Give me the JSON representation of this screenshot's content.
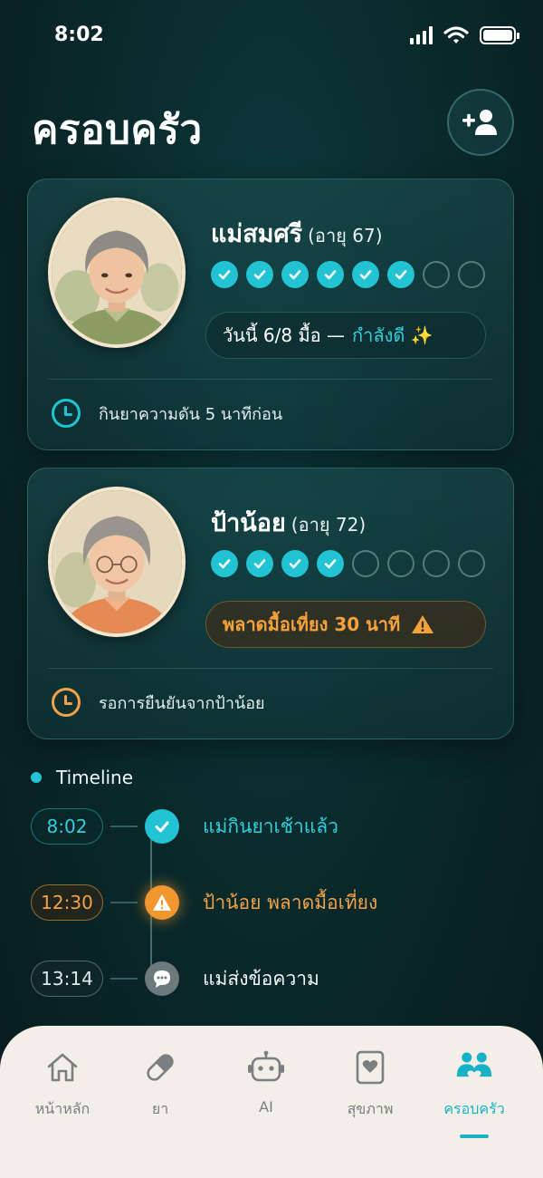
{
  "status_bar": {
    "time": "8:02"
  },
  "header": {
    "title": "ครอบครัว",
    "add_member_icon": "add-user-icon"
  },
  "members": [
    {
      "name": "แม่สมศรี",
      "age": "(อายุ 67)",
      "doses_taken": 6,
      "doses_total": 8,
      "status_text": "วันนี้ 6/8 มื้อ —",
      "status_highlight": "กำลังดี ✨",
      "status_color": "#2fd0dc",
      "footer_text": "กินยาความดัน 5 นาทีก่อน",
      "footer_icon": "clock-icon",
      "footer_icon_color": "#22c3d3"
    },
    {
      "name": "ป้าน้อย",
      "age": "(อายุ 72)",
      "doses_taken": 4,
      "doses_total": 8,
      "status_text": "พลาดมื้อเที่ยง 30 นาที",
      "status_icon": "warning-icon",
      "status_color": "#f5a13c",
      "footer_text": "รอการยืนยันจากป้าน้อย",
      "footer_icon": "clock-icon",
      "footer_icon_color": "#f2a24a"
    }
  ],
  "timeline": {
    "title": "Timeline",
    "events": [
      {
        "time": "8:02",
        "text": "แม่กินยาเช้าแล้ว",
        "icon": "check-icon",
        "color": "#22c3d3"
      },
      {
        "time": "12:30",
        "text": "ป้าน้อย พลาดมื้อเที่ยง",
        "icon": "warning-icon",
        "color": "#f2962e"
      },
      {
        "time": "13:14",
        "text": "แม่ส่งข้อความ",
        "icon": "chat-icon",
        "color": "#6c7a7c"
      }
    ]
  },
  "nav": {
    "items": [
      {
        "label": "หน้าหลัก",
        "icon": "home-icon"
      },
      {
        "label": "ยา",
        "icon": "pill-icon"
      },
      {
        "label": "AI",
        "icon": "robot-icon"
      },
      {
        "label": "สุขภาพ",
        "icon": "health-card-icon"
      },
      {
        "label": "ครอบครัว",
        "icon": "family-icon",
        "active": true
      }
    ],
    "active_color": "#18b2c4"
  }
}
